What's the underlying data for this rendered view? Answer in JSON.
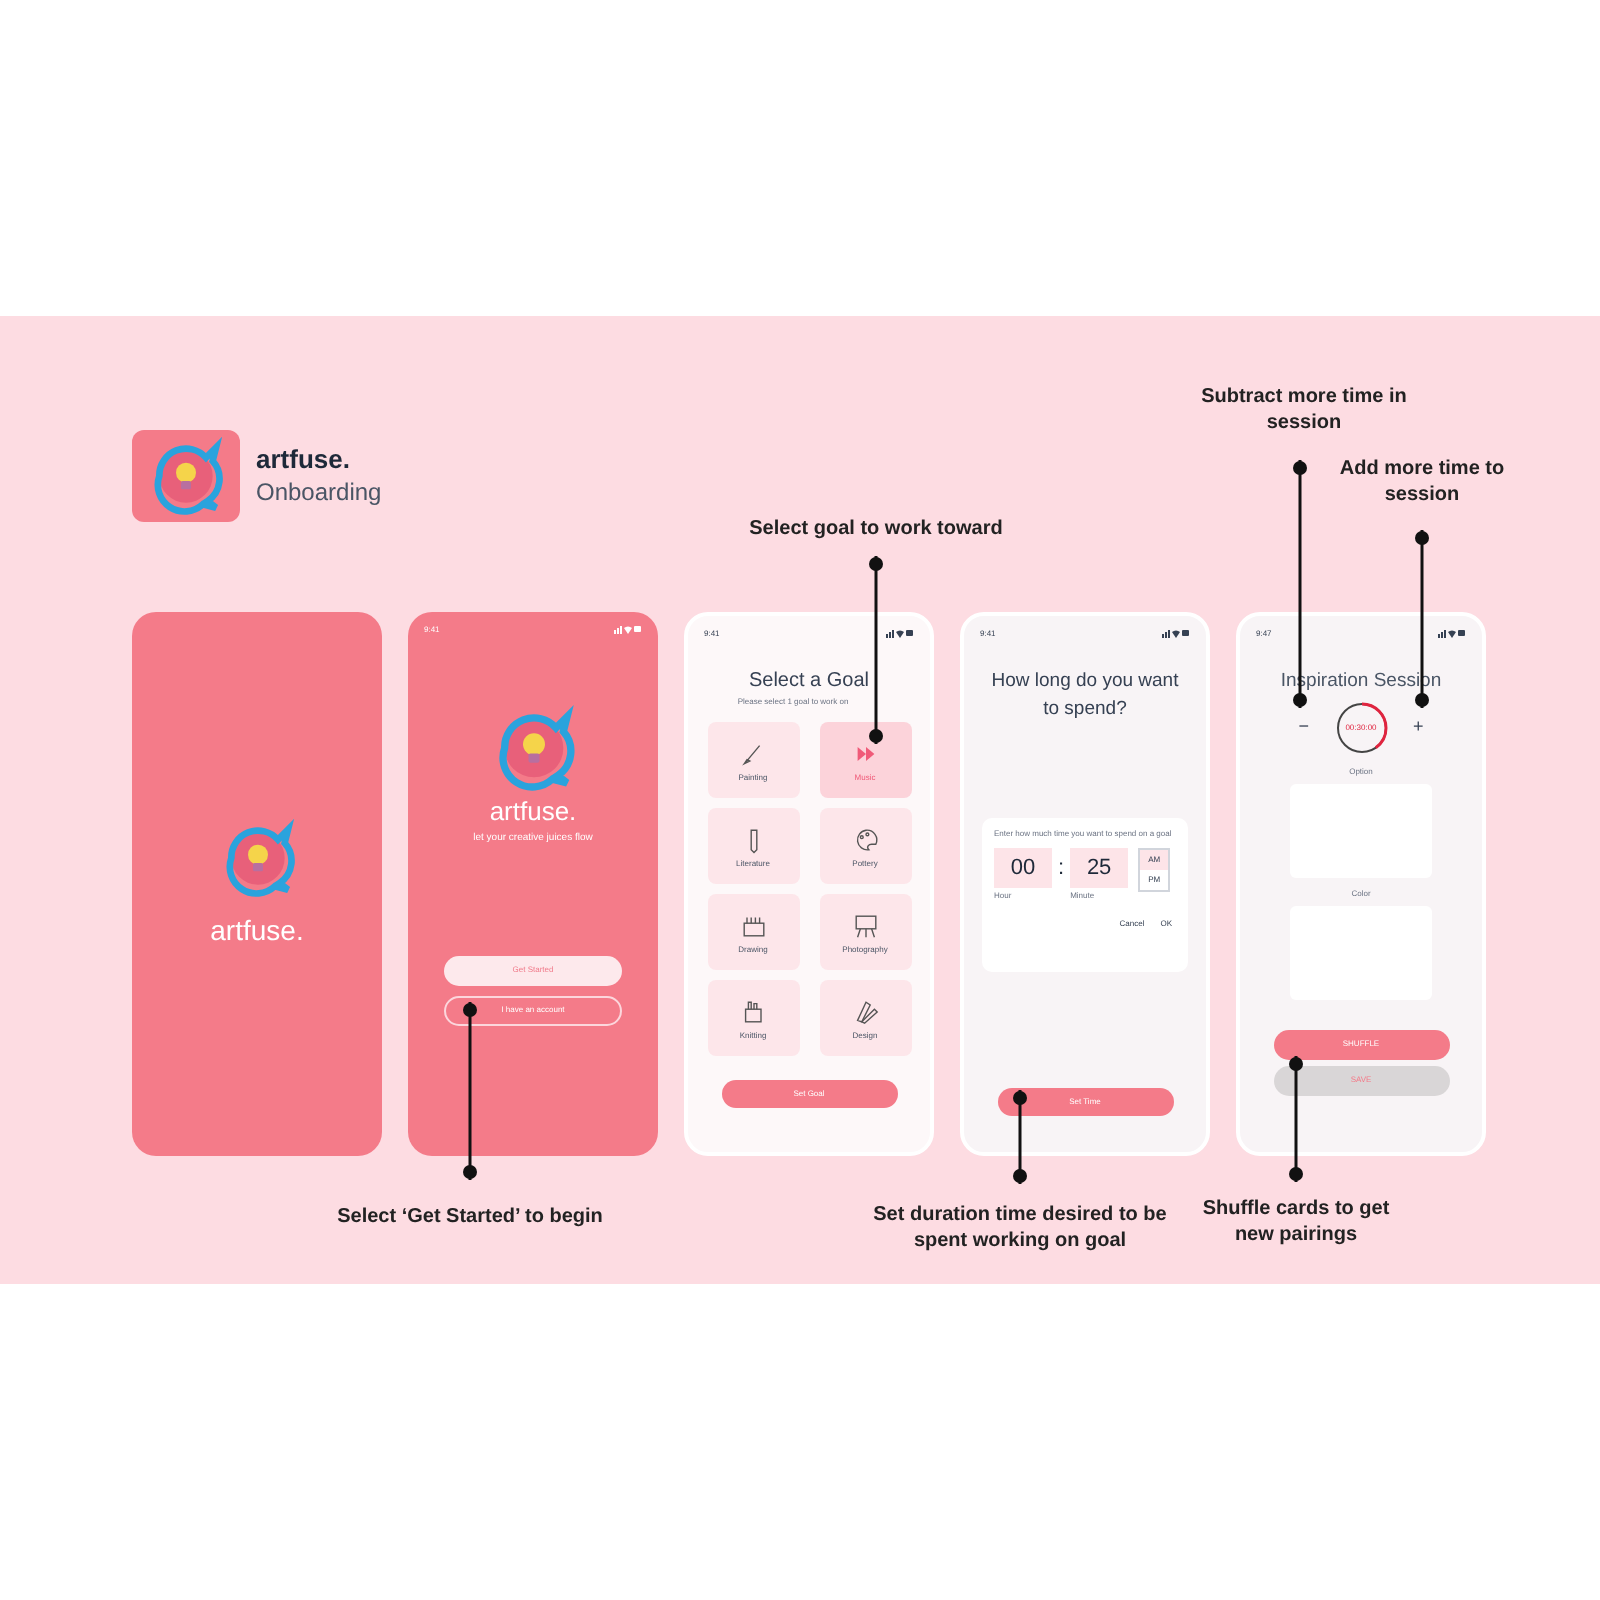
{
  "header": {
    "app_name": "artfuse.",
    "subtitle": "Onboarding"
  },
  "screens": [
    {
      "kind": "splash",
      "app_name": "artfuse."
    },
    {
      "kind": "welcome",
      "time": "9:41",
      "app_name": "artfuse.",
      "tagline": "let your creative juices flow",
      "buttons": [
        {
          "label": "Get Started",
          "kind": "filled"
        },
        {
          "label": "I have an account",
          "kind": "outline"
        }
      ]
    },
    {
      "kind": "goals",
      "time": "9:41",
      "title": "Select a Goal",
      "subtitle": "Please select 1 goal to work on",
      "goals": [
        {
          "label": "Painting",
          "selected": false
        },
        {
          "label": "Music",
          "selected": true
        },
        {
          "label": "Literature",
          "selected": false
        },
        {
          "label": "Pottery",
          "selected": false
        },
        {
          "label": "Drawing",
          "selected": false
        },
        {
          "label": "Photography",
          "selected": false
        },
        {
          "label": "Knitting",
          "selected": false
        },
        {
          "label": "Design",
          "selected": false
        }
      ],
      "button": "Set Goal"
    },
    {
      "kind": "time",
      "time": "9:41",
      "title": "How long do you want to spend?",
      "dialog": {
        "prompt": "Enter how much time you want to spend on a goal",
        "hour": "00",
        "separator": ":",
        "minute": "25",
        "hour_label": "Hour",
        "minute_label": "Minute",
        "periods": [
          {
            "label": "AM",
            "selected": true
          },
          {
            "label": "PM",
            "selected": false
          }
        ],
        "actions": [
          "Cancel",
          "OK"
        ]
      },
      "button": "Set Time"
    },
    {
      "kind": "session",
      "time": "9:47",
      "title": "Inspiration Session",
      "minus": "−",
      "plus": "+",
      "timer": {
        "reading": "00:30:00",
        "level": 0.4
      },
      "cards": [
        "Option",
        "Color"
      ],
      "buttons": [
        {
          "label": "SHUFFLE",
          "kind": "primary"
        },
        {
          "label": "SAVE",
          "kind": "disabled"
        }
      ]
    }
  ],
  "annotations": [
    "Select goal to work toward",
    "Subtract more time in session",
    "Add more time to session",
    "Select ‘Get Started’ to begin",
    "Set duration time desired to be spent working on goal",
    "Shuffle cards to get new pairings"
  ]
}
